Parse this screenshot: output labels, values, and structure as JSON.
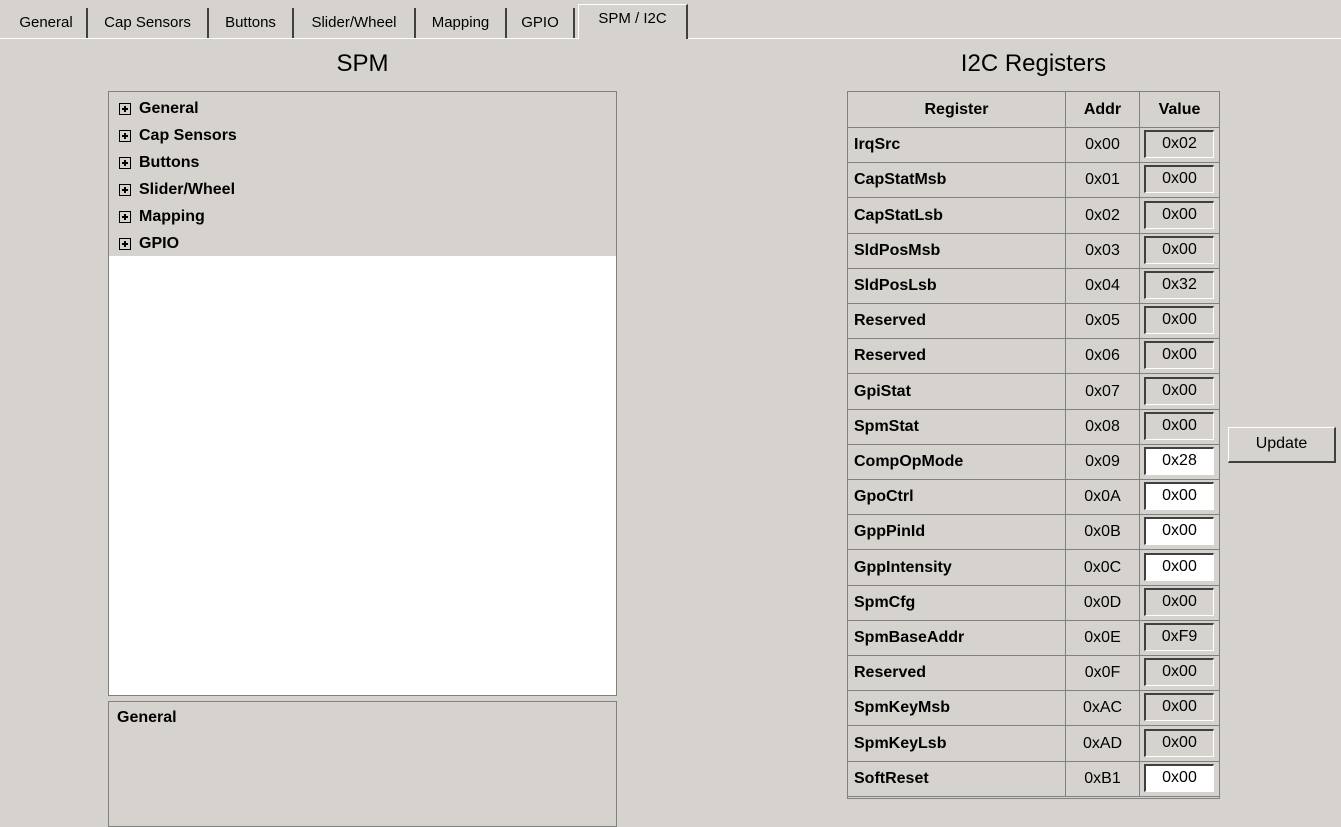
{
  "tabs": [
    {
      "label": "General"
    },
    {
      "label": "Cap Sensors"
    },
    {
      "label": "Buttons"
    },
    {
      "label": "Slider/Wheel"
    },
    {
      "label": "Mapping"
    },
    {
      "label": "GPIO"
    },
    {
      "label": "SPM / I2C",
      "active": true
    }
  ],
  "spm": {
    "title": "SPM",
    "tree": [
      "General",
      "Cap Sensors",
      "Buttons",
      "Slider/Wheel",
      "Mapping",
      "GPIO"
    ],
    "description_title": "General"
  },
  "registers": {
    "title": "I2C Registers",
    "columns": [
      "Register",
      "Addr",
      "Value"
    ],
    "rows": [
      {
        "name": "IrqSrc",
        "addr": "0x00",
        "value": "0x02",
        "editable": false
      },
      {
        "name": "CapStatMsb",
        "addr": "0x01",
        "value": "0x00",
        "editable": false
      },
      {
        "name": "CapStatLsb",
        "addr": "0x02",
        "value": "0x00",
        "editable": false
      },
      {
        "name": "SldPosMsb",
        "addr": "0x03",
        "value": "0x00",
        "editable": false
      },
      {
        "name": "SldPosLsb",
        "addr": "0x04",
        "value": "0x32",
        "editable": false
      },
      {
        "name": "Reserved",
        "addr": "0x05",
        "value": "0x00",
        "editable": false
      },
      {
        "name": "Reserved",
        "addr": "0x06",
        "value": "0x00",
        "editable": false
      },
      {
        "name": "GpiStat",
        "addr": "0x07",
        "value": "0x00",
        "editable": false
      },
      {
        "name": "SpmStat",
        "addr": "0x08",
        "value": "0x00",
        "editable": false
      },
      {
        "name": "CompOpMode",
        "addr": "0x09",
        "value": "0x28",
        "editable": true
      },
      {
        "name": "GpoCtrl",
        "addr": "0x0A",
        "value": "0x00",
        "editable": true
      },
      {
        "name": "GppPinId",
        "addr": "0x0B",
        "value": "0x00",
        "editable": true
      },
      {
        "name": "GppIntensity",
        "addr": "0x0C",
        "value": "0x00",
        "editable": true
      },
      {
        "name": "SpmCfg",
        "addr": "0x0D",
        "value": "0x00",
        "editable": false
      },
      {
        "name": "SpmBaseAddr",
        "addr": "0x0E",
        "value": "0xF9",
        "editable": false
      },
      {
        "name": "Reserved",
        "addr": "0x0F",
        "value": "0x00",
        "editable": false
      },
      {
        "name": "SpmKeyMsb",
        "addr": "0xAC",
        "value": "0x00",
        "editable": false
      },
      {
        "name": "SpmKeyLsb",
        "addr": "0xAD",
        "value": "0x00",
        "editable": false
      },
      {
        "name": "SoftReset",
        "addr": "0xB1",
        "value": "0x00",
        "editable": true
      }
    ],
    "update_label": "Update"
  }
}
